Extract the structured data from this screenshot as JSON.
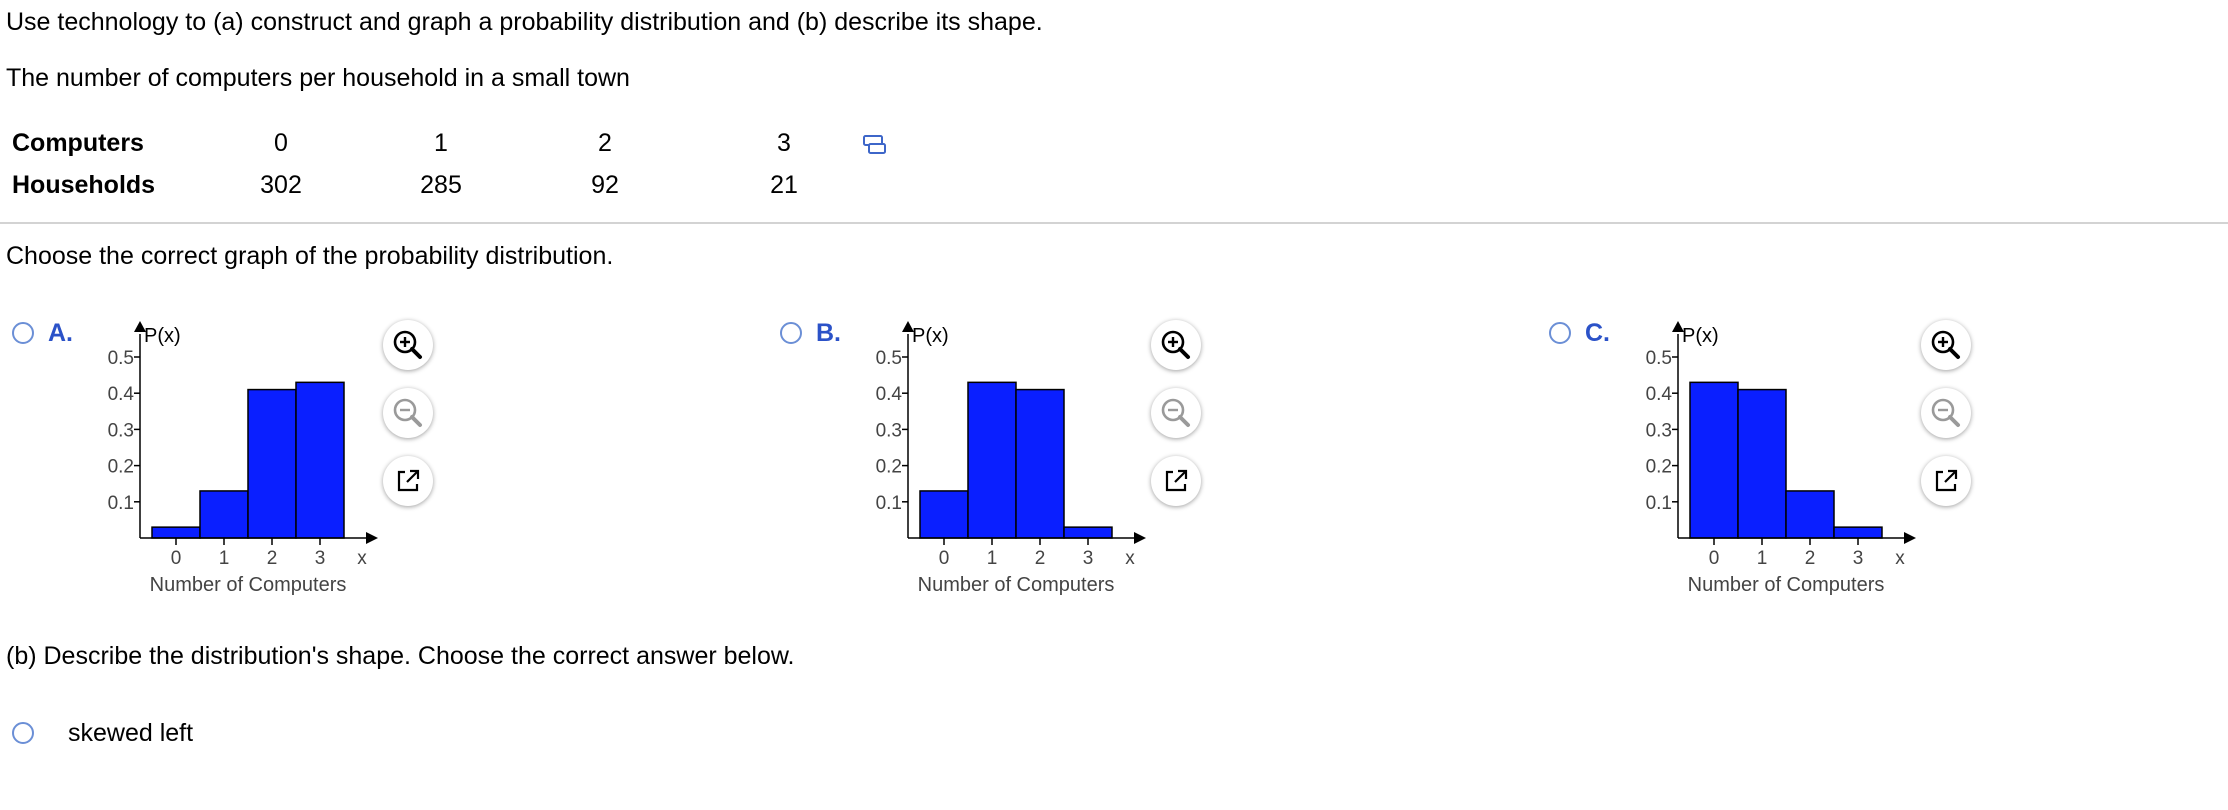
{
  "question": {
    "intro": "Use technology to (a) construct and graph a probability distribution and (b) describe its shape.",
    "subtitle": "The number of computers per household in a small town"
  },
  "table": {
    "row1_label": "Computers",
    "row2_label": "Households",
    "computers": [
      "0",
      "1",
      "2",
      "3"
    ],
    "households": [
      "302",
      "285",
      "92",
      "21"
    ]
  },
  "part_a": {
    "prompt": "Choose the correct graph of the probability distribution.",
    "options": [
      {
        "letter": "A."
      },
      {
        "letter": "B."
      },
      {
        "letter": "C."
      }
    ]
  },
  "part_b": {
    "prompt": "(b) Describe the distribution's shape. Choose the correct answer below.",
    "choices": [
      {
        "label": "skewed left"
      }
    ]
  },
  "colors": {
    "bar_fill": "#0a1fff",
    "option_letter": "#2b52c8",
    "radio_border": "#6b8fd6",
    "divider": "#d3d3d3"
  },
  "icons": [
    "copy-icon",
    "zoom-in-icon",
    "zoom-out-icon",
    "open-external-icon"
  ],
  "chart_data": [
    {
      "type": "bar",
      "option": "A.",
      "categories": [
        "0",
        "1",
        "2",
        "3"
      ],
      "values": [
        0.03,
        0.13,
        0.41,
        0.43
      ],
      "ylabel": "P(x)",
      "xlabel": "Number of Computers",
      "x_axis_end_label": "x",
      "yticks": [
        "0.1",
        "0.2",
        "0.3",
        "0.4",
        "0.5"
      ],
      "ylim": [
        0,
        0.5
      ]
    },
    {
      "type": "bar",
      "option": "B.",
      "categories": [
        "0",
        "1",
        "2",
        "3"
      ],
      "values": [
        0.13,
        0.43,
        0.41,
        0.03
      ],
      "ylabel": "P(x)",
      "xlabel": "Number of Computers",
      "x_axis_end_label": "x",
      "yticks": [
        "0.1",
        "0.2",
        "0.3",
        "0.4",
        "0.5"
      ],
      "ylim": [
        0,
        0.5
      ]
    },
    {
      "type": "bar",
      "option": "C.",
      "categories": [
        "0",
        "1",
        "2",
        "3"
      ],
      "values": [
        0.43,
        0.41,
        0.13,
        0.03
      ],
      "ylabel": "P(x)",
      "xlabel": "Number of Computers",
      "x_axis_end_label": "x",
      "yticks": [
        "0.1",
        "0.2",
        "0.3",
        "0.4",
        "0.5"
      ],
      "ylim": [
        0,
        0.5
      ]
    }
  ]
}
